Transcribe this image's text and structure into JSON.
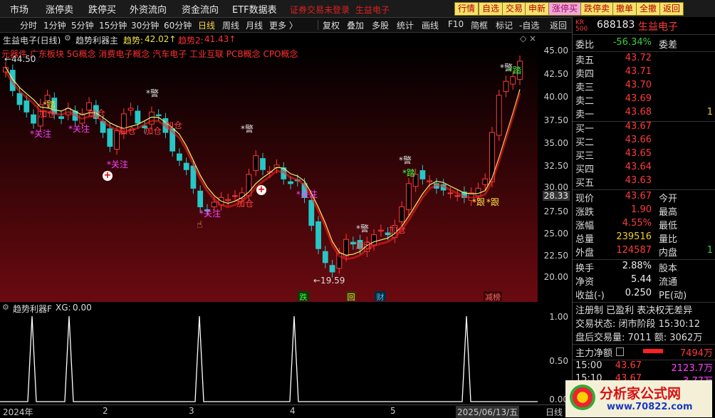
{
  "menu": [
    "市场",
    "涨停卖",
    "跌停买",
    "外资流向",
    "资金流向",
    "ETF数据表"
  ],
  "menu_links": [
    "证券交易未登录",
    "生益电子"
  ],
  "buttons": [
    {
      "label": "行情",
      "style": "y"
    },
    {
      "label": "自选",
      "style": "y"
    },
    {
      "label": "交易",
      "style": "y"
    },
    {
      "label": "申新",
      "style": "y"
    },
    {
      "label": "涨停买",
      "style": "p"
    },
    {
      "label": "跌停卖",
      "style": "y"
    },
    {
      "label": "撤单",
      "style": "y"
    },
    {
      "label": "全撤",
      "style": "y"
    },
    {
      "label": "返回",
      "style": "y"
    }
  ],
  "chart_header": {
    "name": "生益电子(日线)",
    "indicator": "趋势利器主",
    "trend1_label": "趋势:",
    "trend1_value": "42.02↑",
    "trend2_label": "趋势2:",
    "trend2_value": "41.43↑",
    "concepts": "元器件 广东板块 5G概念 消费电子概念 汽车电子 工业互联 PCB概念 CPO概念"
  },
  "periods": [
    "分时",
    "1分钟",
    "5分钟",
    "15分钟",
    "30分钟",
    "60分钟",
    "日线",
    "周线",
    "月线",
    "更多 〉"
  ],
  "active_period": "日线",
  "tools": [
    "复权",
    "叠加",
    "多股",
    "统计",
    "画线",
    "F10",
    "简框",
    "标记",
    "-自选",
    "返回"
  ],
  "price_axis": {
    "labels": [
      "45.00",
      "42.50",
      "40.00",
      "37.50",
      "35.00",
      "32.50",
      "30.00",
      "27.50",
      "25.00",
      "22.50",
      "20.00"
    ],
    "current": "28.33"
  },
  "indicator_panel": {
    "name": "趋势利器F",
    "value_label": "XG:",
    "value": "0.00",
    "axis": [
      "1.00",
      "0.50",
      "0.00"
    ]
  },
  "date_axis": [
    "2024年",
    "2",
    "3",
    "4",
    "5",
    "2025/06/13/五",
    "日线"
  ],
  "events": [
    "跌",
    "回",
    "财",
    "减榜"
  ],
  "annotations": {
    "high": "←44.50",
    "low": "←19.59",
    "watch": "*关注",
    "warn": "*警",
    "add": "加仓",
    "follow": "*跟",
    "hold": "*踏"
  },
  "stock": {
    "code": "688183",
    "name": "生益电子",
    "badge_top": "KR",
    "badge_num": "500"
  },
  "wei": {
    "label": "委比",
    "value": "-56.34%",
    "label2": "委差"
  },
  "asks": [
    {
      "label": "卖五",
      "price": "43.72",
      "vol": ""
    },
    {
      "label": "卖四",
      "price": "43.71",
      "vol": ""
    },
    {
      "label": "卖三",
      "price": "43.70",
      "vol": ""
    },
    {
      "label": "卖二",
      "price": "43.69",
      "vol": ""
    },
    {
      "label": "卖一",
      "price": "43.68",
      "vol": "1"
    }
  ],
  "bids": [
    {
      "label": "买一",
      "price": "43.67",
      "vol": ""
    },
    {
      "label": "买二",
      "price": "43.66",
      "vol": ""
    },
    {
      "label": "买三",
      "price": "43.65",
      "vol": ""
    },
    {
      "label": "买四",
      "price": "43.64",
      "vol": ""
    },
    {
      "label": "买五",
      "price": "43.63",
      "vol": ""
    }
  ],
  "quote": [
    {
      "l1": "现价",
      "v1": "43.67",
      "l2": "今开",
      "v2": ""
    },
    {
      "l1": "涨跌",
      "v1": "1.90",
      "l2": "最高",
      "v2": ""
    },
    {
      "l1": "涨幅",
      "v1": "4.55%",
      "l2": "最低",
      "v2": ""
    },
    {
      "l1": "总量",
      "v1": "239516",
      "l2": "量比",
      "v2": ""
    },
    {
      "l1": "外盘",
      "v1": "124587",
      "l2": "内盘",
      "v2": "1"
    }
  ],
  "stats": [
    {
      "l1": "换手",
      "v1": "2.88%",
      "l2": "股本"
    },
    {
      "l1": "净资",
      "v1": "5.44",
      "l2": "流通"
    },
    {
      "l1": "收益(-)",
      "v1": "0.250",
      "l2": "PE(动)"
    }
  ],
  "reg": "注册制 已盈利 表决权无差异",
  "trade_status": "交易状态: 闭市阶段 15:30:12",
  "after_hours": "盘后交易量: 7011  额: 3062万",
  "net_flow": {
    "label": "主力净额",
    "value": "7494万"
  },
  "ticks": [
    {
      "time": "15:00",
      "price": "43.67",
      "amount": "2123.7万"
    },
    {
      "time": "15:10",
      "price": "43.67",
      "amount": "3.77万"
    }
  ],
  "watermark": {
    "main": "分析家公式网",
    "url": "www.70822.com"
  },
  "colors": {
    "up": "#ff3b3b",
    "down": "#27c7c7",
    "ma": "#f2f26a",
    "trend": "#ff2020"
  },
  "chart_data": {
    "type": "candlestick",
    "ylim": [
      19,
      45.5
    ],
    "series": [
      {
        "name": "趋势",
        "values": [
          42.02
        ]
      },
      {
        "name": "趋势2",
        "values": [
          41.43
        ]
      }
    ],
    "highlights": {
      "high": 44.5,
      "low": 19.59,
      "current": 28.33
    },
    "closes": [
      43.0,
      40.5,
      39.0,
      38.2,
      37.0,
      39.0,
      40.0,
      38.0,
      37.5,
      38.6,
      37.3,
      38.0,
      39.2,
      37.5,
      36.0,
      34.5,
      36.2,
      38.0,
      38.6,
      37.0,
      36.5,
      38.2,
      37.8,
      36.0,
      34.0,
      33.0,
      32.0,
      30.0,
      28.0,
      27.6,
      28.5,
      29.0,
      28.8,
      29.2,
      29.5,
      31.5,
      33.5,
      32.0,
      31.8,
      32.5,
      31.0,
      30.5,
      30.8,
      29.0,
      26.0,
      23.5,
      22.0,
      21.0,
      23.0,
      24.5,
      24.0,
      23.5,
      24.2,
      25.0,
      25.5,
      25.0,
      26.0,
      28.0,
      30.5,
      31.5,
      31.0,
      30.8,
      30.0,
      29.8,
      29.5,
      29.2,
      29.0,
      29.5,
      30.0,
      31.0,
      36.0,
      40.0,
      41.5,
      42.0,
      43.67
    ]
  }
}
